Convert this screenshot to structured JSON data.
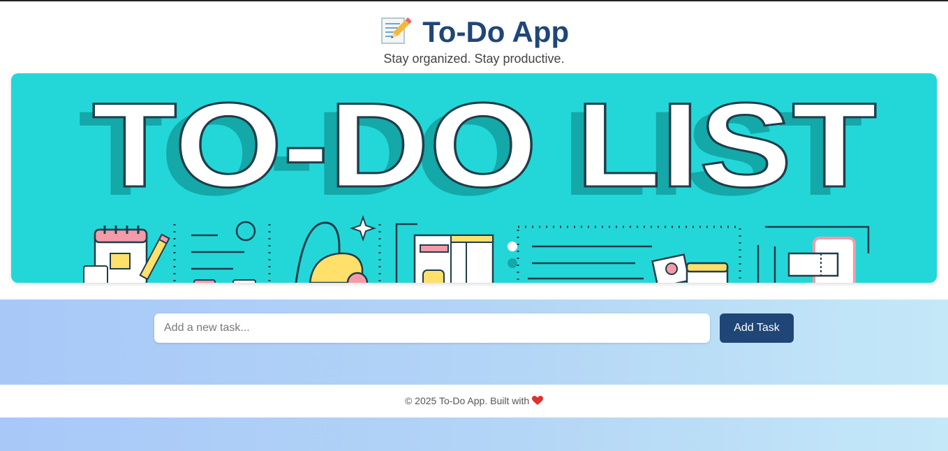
{
  "header": {
    "title": "To-Do App",
    "title_icon": "memo-icon",
    "subtitle": "Stay organized. Stay productive."
  },
  "banner": {
    "text": "TO-DO LIST",
    "background_color": "#23d7d8"
  },
  "task_form": {
    "input_placeholder": "Add a new task...",
    "input_value": "",
    "add_button_label": "Add Task"
  },
  "footer": {
    "text": "© 2025 To-Do App. Built with",
    "heart_icon": "heart-icon"
  },
  "colors": {
    "accent": "#1f4677",
    "banner": "#23d7d8",
    "background_start": "#a8c8f8",
    "background_end": "#c4e8f8"
  }
}
